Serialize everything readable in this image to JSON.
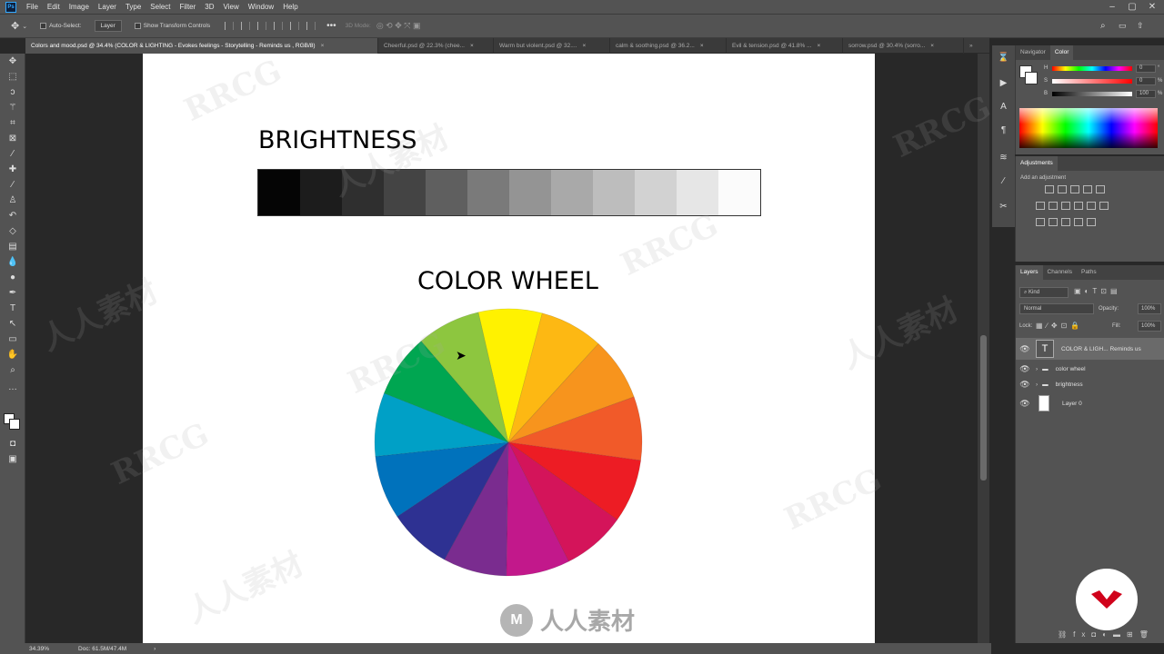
{
  "app": {
    "logo": "Ps"
  },
  "menu": [
    "File",
    "Edit",
    "Image",
    "Layer",
    "Type",
    "Select",
    "Filter",
    "3D",
    "View",
    "Window",
    "Help"
  ],
  "options": {
    "auto_select_label": "Auto-Select:",
    "auto_select_value": "Layer",
    "show_transform_label": "Show Transform Controls",
    "mode_3d_label": "3D Mode:"
  },
  "tabs": [
    {
      "label": "Colors and mood.psd @ 34.4% (COLOR & LIGHTING - Evokes feelings - Storytelling - Reminds us , RGB/8)",
      "active": true
    },
    {
      "label": "Cheerful.psd @ 22.3% (chee...",
      "active": false
    },
    {
      "label": "Warm but violent.psd @ 32....",
      "active": false
    },
    {
      "label": "calm & soothing.psd @ 36.2...",
      "active": false
    },
    {
      "label": "Evil & tension.psd @ 41.8% ...",
      "active": false
    },
    {
      "label": "sorrow.psd @ 30.4% (sorro...",
      "active": false
    }
  ],
  "document": {
    "brightness_title": "BRIGHTNESS",
    "brightness_steps": [
      "#050505",
      "#1c1c1c",
      "#2f2f2f",
      "#444444",
      "#5f5f5f",
      "#7a7a7a",
      "#949494",
      "#a9a9a9",
      "#bdbdbd",
      "#d2d2d2",
      "#e6e6e6",
      "#fbfbfb"
    ],
    "wheel_title": "COLOR WHEEL",
    "wheel_colors": [
      "#fff200",
      "#fdb813",
      "#f7941d",
      "#f15a29",
      "#ed1c24",
      "#d4145a",
      "#c2188b",
      "#7a2c8f",
      "#2e3192",
      "#0072bc",
      "#00a0c6",
      "#00a651",
      "#8dc63f"
    ]
  },
  "right_panels": {
    "color_tabs": [
      "Navigator",
      "Color"
    ],
    "color_active": "Color",
    "h_label": "H",
    "s_label": "S",
    "b_label": "B",
    "h_value": "0",
    "s_value": "0",
    "b_value": "100",
    "pct": "%",
    "adjustments_title": "Adjustments",
    "adjustments_hint": "Add an adjustment",
    "layer_tabs": [
      "Layers",
      "Channels",
      "Paths"
    ],
    "layers_active": "Layers",
    "kind_label": "Kind",
    "blend_mode": "Normal",
    "opacity_label": "Opacity:",
    "opacity_value": "100%",
    "lock_label": "Lock:",
    "fill_label": "Fill:",
    "fill_value": "100%",
    "layers": [
      {
        "name": "COLOR & LIGH... Reminds us",
        "kind": "text"
      },
      {
        "name": "color wheel",
        "kind": "group"
      },
      {
        "name": "brightness",
        "kind": "group"
      },
      {
        "name": "Layer 0",
        "kind": "pixel"
      }
    ]
  },
  "status": {
    "zoom": "34.39%",
    "doc": "Doc: 61.5M/47.4M"
  },
  "watermarks": {
    "brand": "RRCG",
    "cn": "人人素材",
    "bottom_logo": "人人素材"
  }
}
